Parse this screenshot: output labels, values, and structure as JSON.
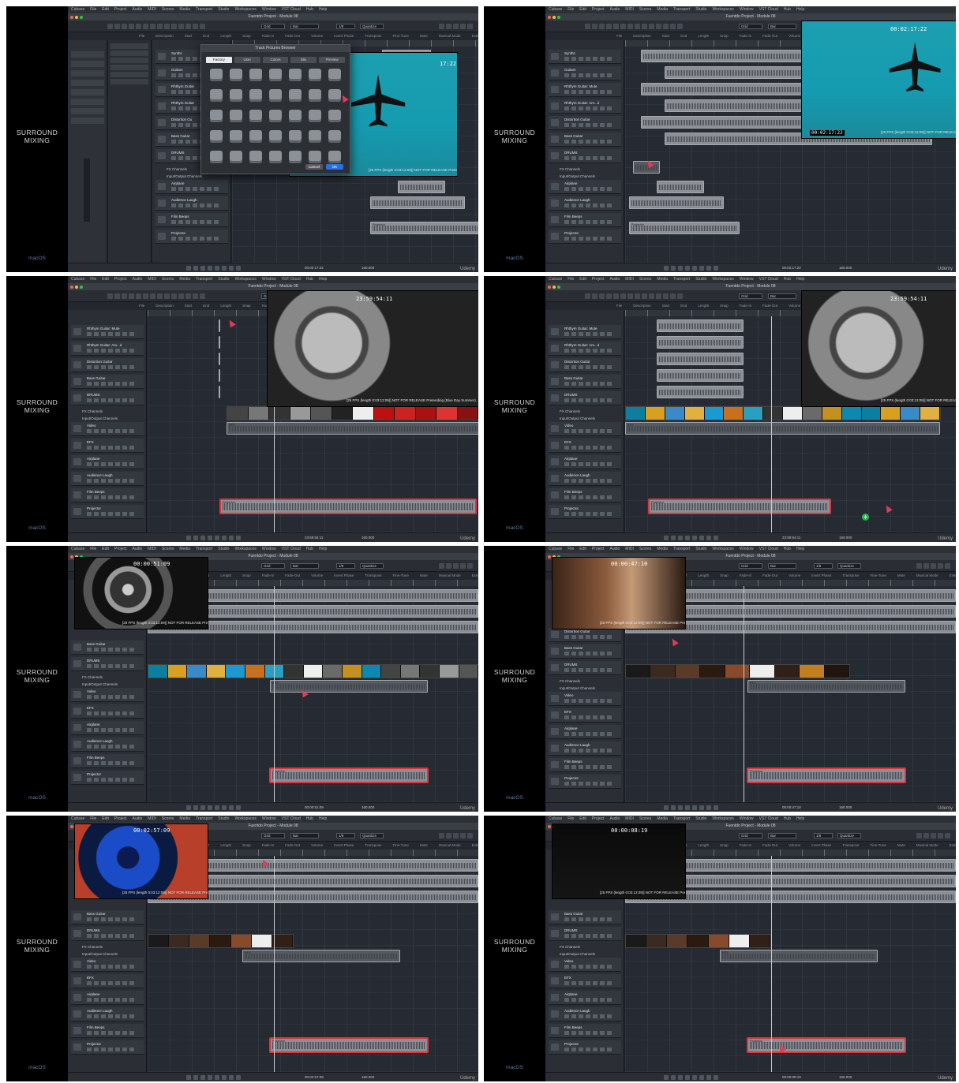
{
  "course_title": "SURROUND MIXING",
  "os_label": "macOS",
  "watermark": "Udemy",
  "app": {
    "menu": [
      "Cubase",
      "File",
      "Edit",
      "Project",
      "Audio",
      "MIDI",
      "Scores",
      "Media",
      "Transport",
      "Studio",
      "Workspaces",
      "Window",
      "VST Cloud",
      "Hub",
      "Help"
    ],
    "window_title": "Fuentdo Project - Module 08",
    "toolbar_fields": [
      "Grid",
      "Bar",
      "1/8",
      "Quantize"
    ],
    "info_labels": [
      "File",
      "Description",
      "Start",
      "End",
      "Length",
      "Snap",
      "Fade-In",
      "Fade-Out",
      "Volume",
      "Invert Phase",
      "Transpose",
      "Fine-Tune",
      "Mute",
      "Musical Mode",
      "Extension"
    ]
  },
  "tracks": {
    "frame1": [
      "Synths",
      "Guitars",
      "Rhthym Guitar",
      "Rhthym Guitar",
      "Distortion Gu",
      "Bass Guitar",
      "DRUMS",
      "FX Channels",
      "Input/Output Channels",
      "Airplane",
      "Audience Laugh",
      "Film Beeps",
      "Projector"
    ],
    "frame2": [
      "Synths",
      "Guitars",
      "Rhthym Guitar: Mute",
      "Rhthym Guitar: Am...d",
      "Distortion Guitar",
      "Bass Guitar",
      "DRUMS",
      "FX Channels",
      "Input/Output Channels",
      "Airplane",
      "Audience Laugh",
      "Film Beeps",
      "Projector"
    ],
    "frame3": [
      "Rhthym Guitar: Mute",
      "Rhthym Guitar: Am...d",
      "Distortion Guitar",
      "Bass Guitar",
      "DRUMS",
      "FX Channels",
      "Input/Output Channels",
      "Video",
      "EFX",
      "Airplane",
      "Audience Laugh",
      "Film Beeps",
      "Projector"
    ],
    "frame4": [
      "Rhthym Guitar: Mute",
      "Rhthym Guitar: Am...d",
      "Distortion Guitar",
      "Bass Guitar",
      "DRUMS",
      "FX Channels",
      "Input/Output Channels",
      "Video",
      "EFX",
      "Airplane",
      "Audience Laugh",
      "Film Beeps",
      "Projector"
    ],
    "frame5": [
      "Bass Guitar",
      "DRUMS",
      "FX Channels",
      "Input/Output Channels",
      "Video",
      "EFX",
      "Airplane",
      "Audience Laugh",
      "Film Beeps",
      "Projector"
    ],
    "frame6": [
      "Distortion Guitar",
      "Bass Guitar",
      "DRUMS",
      "FX Channels",
      "Input/Output Channels",
      "Video",
      "EFX",
      "Airplane",
      "Audience Laugh",
      "Film Beeps",
      "Projector"
    ],
    "frame7": [
      "Bass Guitar",
      "DRUMS",
      "FX Channels",
      "Input/Output Channels",
      "Video",
      "EFX",
      "Airplane",
      "Audience Laugh",
      "Film Beeps",
      "Projector"
    ],
    "frame8": [
      "Bass Guitar",
      "DRUMS",
      "FX Channels",
      "Input/Output Channels",
      "Video",
      "EFX",
      "Airplane",
      "Audience Laugh",
      "Film Beeps",
      "Projector"
    ]
  },
  "browser": {
    "title": "Track Pictures Browser",
    "tabs": [
      "Factory",
      "User",
      "Colors",
      "Mix",
      "Preview"
    ],
    "cancel": "Cancel",
    "ok": "OK"
  },
  "video": {
    "caption": "[25 FPS (length 0:03:12:09)] NOT FOR RELEASE   Pretending (Blue Day Summer)",
    "frame1_tc": "17:22",
    "frame2_tc": "00:02:17:22",
    "frame2_tc_bottom": "00:02:17:22",
    "frame3_tc": "23:59:54:11",
    "frame4_tc": "23:59:54:11",
    "frame5_tc": "00:00:51:09",
    "frame6_tc": "00:00:47:10",
    "frame7_tc": "00:02:57:09",
    "frame8_tc": "00:00:08:19"
  },
  "events": {
    "projector": "Projector",
    "efx": "EFX",
    "drums": "DRUMS"
  },
  "transport": {
    "frame1": "00:02:17:22",
    "frame2": "00:02:17:22",
    "frame3": "23:59:54:11",
    "frame4": "23:59:54:11",
    "frame5": "00:00:51:09",
    "frame6": "00:00:47:10",
    "frame7": "00:02:57:09",
    "frame8": "00:00:08:19",
    "tempo": "160.000"
  }
}
